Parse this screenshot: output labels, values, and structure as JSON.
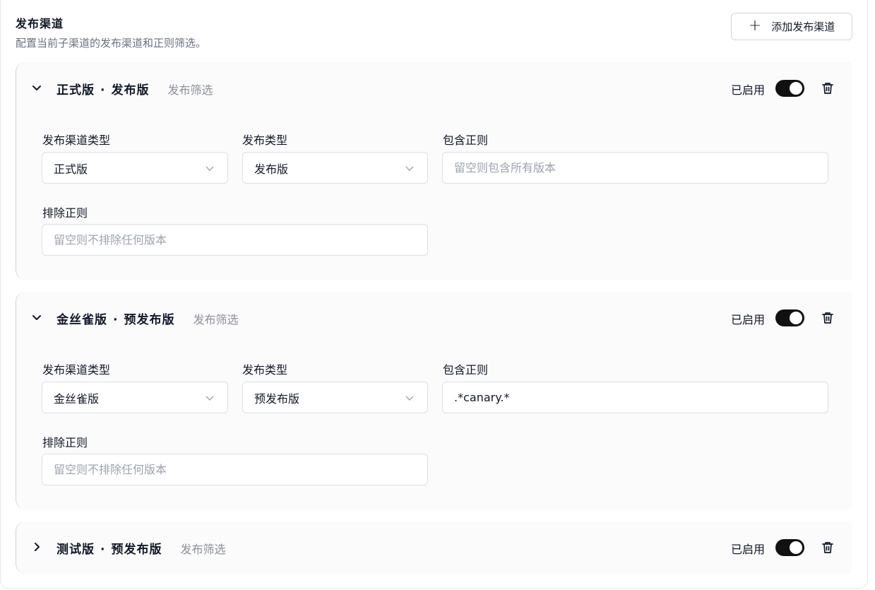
{
  "section": {
    "title": "发布渠道",
    "description": "配置当前子渠道的发布渠道和正则筛选。",
    "add_button_label": "添加发布渠道"
  },
  "labels": {
    "channel_type": "发布渠道类型",
    "release_type": "发布类型",
    "include_regex": "包含正则",
    "exclude_regex": "排除正则",
    "filter_sub": "发布筛选",
    "enabled": "已启用",
    "dot": "·"
  },
  "cards": [
    {
      "name": "正式版",
      "release": "发布版",
      "expanded": true,
      "enabled": true,
      "channel_type_value": "正式版",
      "release_type_value": "发布版",
      "include_value": "",
      "include_placeholder": "留空则包含所有版本",
      "exclude_value": "",
      "exclude_placeholder": "留空则不排除任何版本"
    },
    {
      "name": "金丝雀版",
      "release": "预发布版",
      "expanded": true,
      "enabled": true,
      "channel_type_value": "金丝雀版",
      "release_type_value": "预发布版",
      "include_value": ".*canary.*",
      "include_placeholder": "留空则包含所有版本",
      "exclude_value": "",
      "exclude_placeholder": "留空则不排除任何版本"
    },
    {
      "name": "测试版",
      "release": "预发布版",
      "expanded": false,
      "enabled": true
    }
  ],
  "icons": {
    "add": "plus-icon",
    "expanded": "chevron-down-icon",
    "collapsed": "chevron-right-icon",
    "select": "chevron-down-icon",
    "delete": "trash-icon"
  },
  "colors": {
    "toggle_on": "#111111",
    "card_bg": "#fbfbfc",
    "muted_text": "#8b8f98"
  }
}
